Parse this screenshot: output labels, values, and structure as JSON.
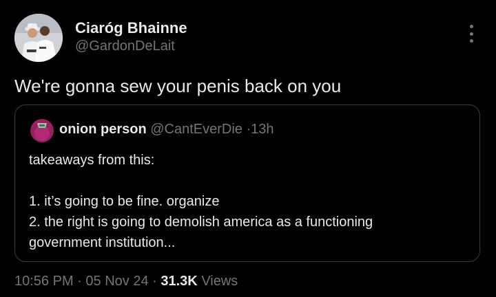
{
  "tweet": {
    "author": {
      "name": "Ciaróg Bhainne",
      "handle": "@GardonDeLait"
    },
    "text": "We're gonna sew your penis back on you",
    "quoted": {
      "author_name": "onion person",
      "author_handle": "@CantEverDie",
      "separator": "·",
      "time": "13h",
      "lines": [
        "takeaways from this:",
        "",
        "1.  it’s going to be fine.  organize",
        "2.  the right is going to demolish america as a functioning",
        "government institution..."
      ]
    },
    "meta": {
      "time": "10:56 PM",
      "separator": "·",
      "date": "05 Nov 24",
      "views_count": "31.3K",
      "views_label": "Views"
    }
  },
  "icons": {
    "more": "more-horizontal-dots-icon"
  },
  "colors": {
    "background": "#000000",
    "text_primary": "#e7e9ea",
    "text_secondary": "#71767b",
    "border": "#3a3e42",
    "quote_avatar": "#9b1f63"
  }
}
